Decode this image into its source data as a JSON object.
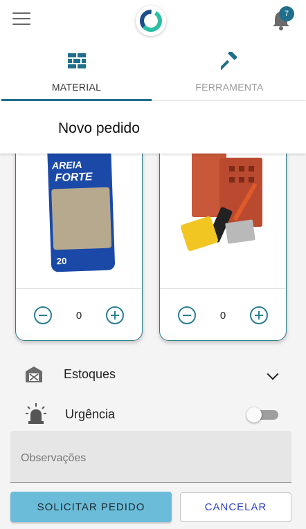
{
  "header": {
    "menu_icon": "hamburger-menu-icon",
    "logo": "app-logo",
    "notification_icon": "bell-icon",
    "notification_count": "7"
  },
  "tabs": [
    {
      "label": "MATERIAL",
      "icon": "bricks-icon",
      "active": true
    },
    {
      "label": "FERRAMENTA",
      "icon": "hammer-icon",
      "active": false
    }
  ],
  "page": {
    "title": "Novo pedido"
  },
  "products": [
    {
      "image": "areia-forte-sand-bag",
      "bag_brand_line1": "AREIA",
      "bag_brand_line2": "FORTE",
      "bag_weight": "20",
      "quantity": "0"
    },
    {
      "image": "bricks-and-tools",
      "quantity": "0"
    }
  ],
  "form": {
    "estoques_label": "Estoques",
    "estoques_icon": "warehouse-icon",
    "urgencia_label": "Urgência",
    "urgencia_icon": "siren-alarm-icon",
    "urgencia_enabled": false,
    "observacoes_placeholder": "Observações"
  },
  "actions": {
    "submit_label": "SOLICITAR PEDIDO",
    "cancel_label": "CANCELAR"
  },
  "colors": {
    "accent": "#1f6e8c",
    "card_border": "#2a7f8f",
    "primary_button": "#6bbcd8",
    "cancel_text": "#2b3fc7"
  }
}
